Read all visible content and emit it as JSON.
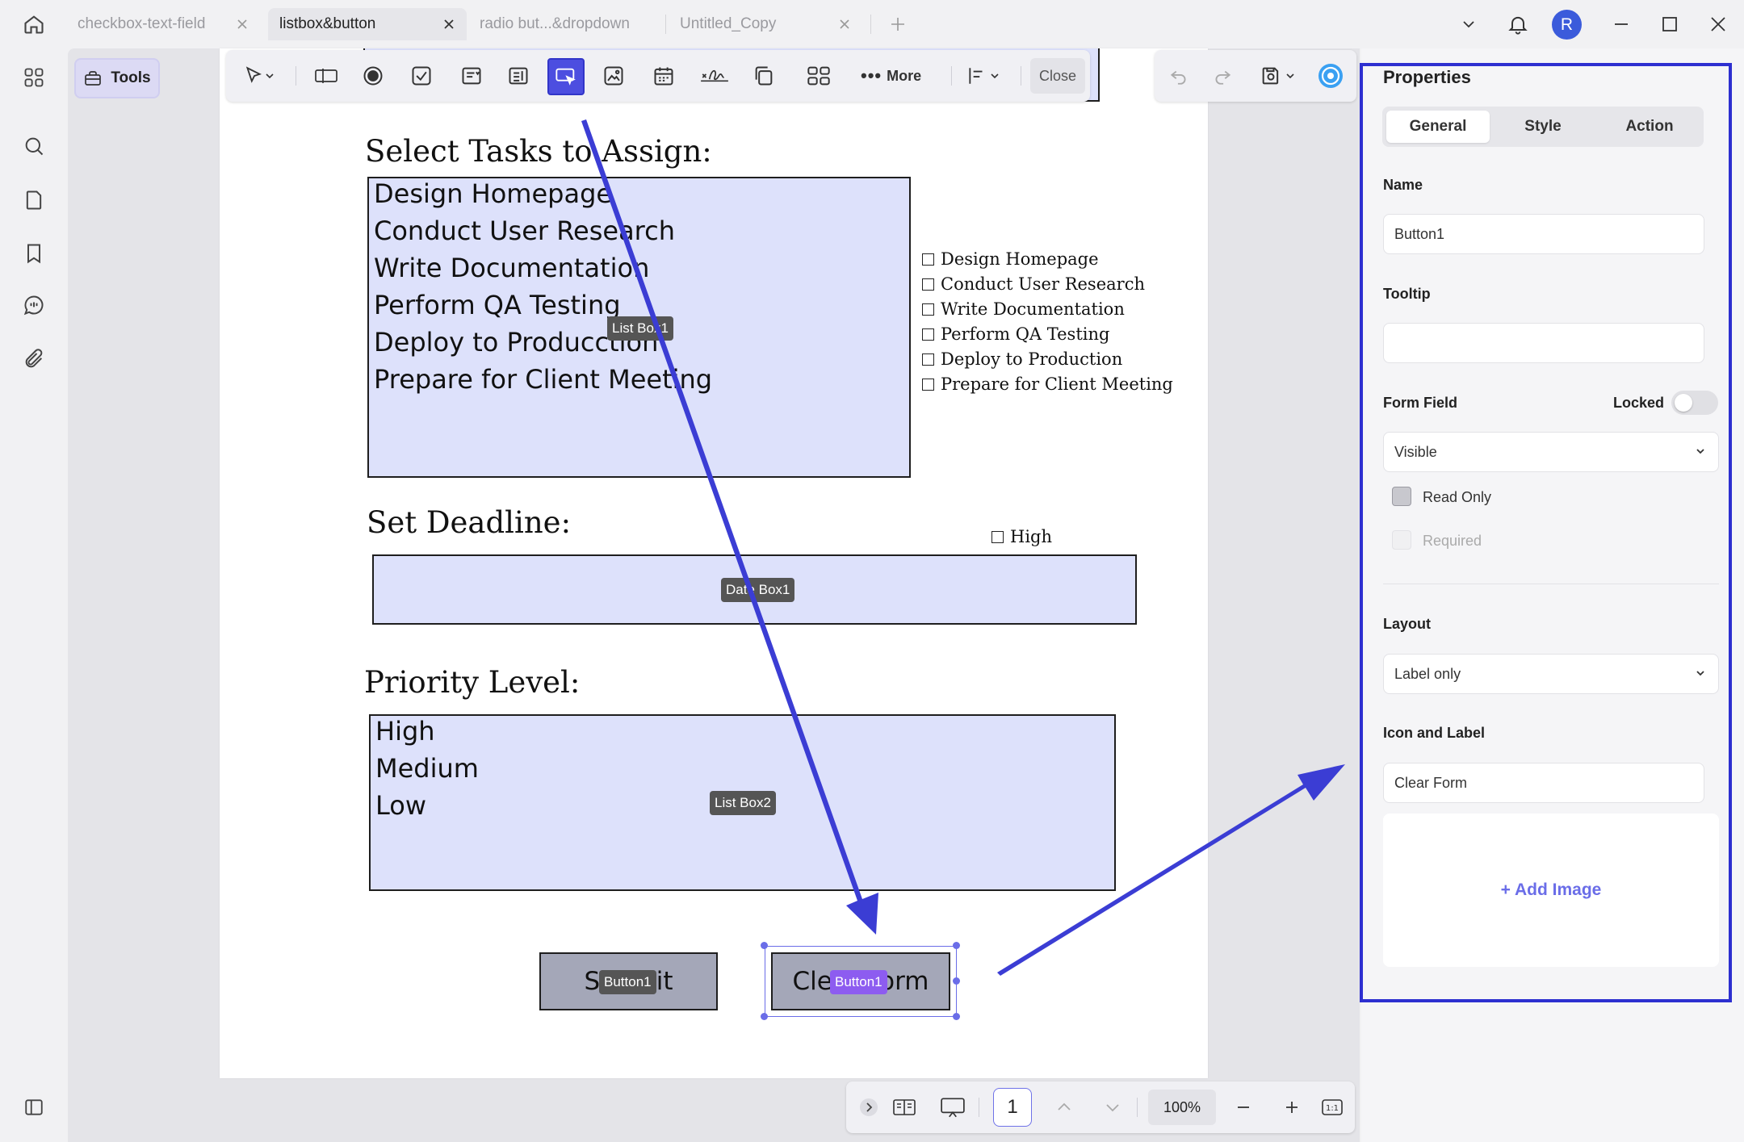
{
  "tabs": [
    {
      "label": "checkbox-text-field",
      "active": false
    },
    {
      "label": "listbox&button",
      "active": true
    },
    {
      "label": "radio but...&dropdown",
      "active": false
    },
    {
      "label": "Untitled_Copy",
      "active": false
    }
  ],
  "user": {
    "avatar_letter": "R"
  },
  "left_rail": {
    "icons": [
      "apps-grid-icon",
      "search-icon",
      "page-icon",
      "bookmark-icon",
      "comment-icon",
      "attachment-icon"
    ],
    "bottom_icon": "sidebar-toggle-icon"
  },
  "toolbar": {
    "tools_label": "Tools",
    "more_label": "More",
    "close_label": "Close",
    "active_tool": "button-tool-icon"
  },
  "document": {
    "tasks_heading": "Select Tasks to Assign:",
    "listbox1": {
      "items": [
        "Design Homepage",
        "Conduct User Research",
        "Write Documentation",
        "Perform QA Testing",
        "Deploy to Producction",
        "Prepare for Client Meeting"
      ],
      "tag": "List Box1"
    },
    "checkboxes": [
      "Design Homepage",
      "Conduct User Research",
      "Write Documentation",
      "Perform QA Testing",
      "Deploy to Production",
      "Prepare for Client Meeting"
    ],
    "deadline_heading": "Set Deadline:",
    "high_checkbox": "High",
    "datebox_tag": "Date Box1",
    "priority_heading": "Priority Level:",
    "listbox2": {
      "items": [
        "High",
        "Medium",
        "Low"
      ],
      "tag": "List Box2"
    },
    "submit_button": {
      "label": "Submit",
      "tag": "Button1"
    },
    "clear_button": {
      "label": "Clear Form",
      "tag": "Button1"
    }
  },
  "bottom_nav": {
    "page_number": "1",
    "zoom": "100%"
  },
  "properties": {
    "title": "Properties",
    "tabs": [
      "General",
      "Style",
      "Action"
    ],
    "active_tab": "General",
    "name_label": "Name",
    "name_value": "Button1",
    "tooltip_label": "Tooltip",
    "tooltip_value": "",
    "form_field_label": "Form Field",
    "locked_label": "Locked",
    "locked": false,
    "visibility": "Visible",
    "read_only_label": "Read Only",
    "required_label": "Required",
    "layout_label": "Layout",
    "layout_value": "Label only",
    "icon_label_heading": "Icon and Label",
    "icon_label_value": "Clear Form",
    "add_image_label": "+ Add Image"
  },
  "colors": {
    "accent": "#6a6de8",
    "annotation_blue": "#3b3dd4",
    "field_fill": "#dde1fb",
    "button_fill": "#a4a7b8"
  }
}
